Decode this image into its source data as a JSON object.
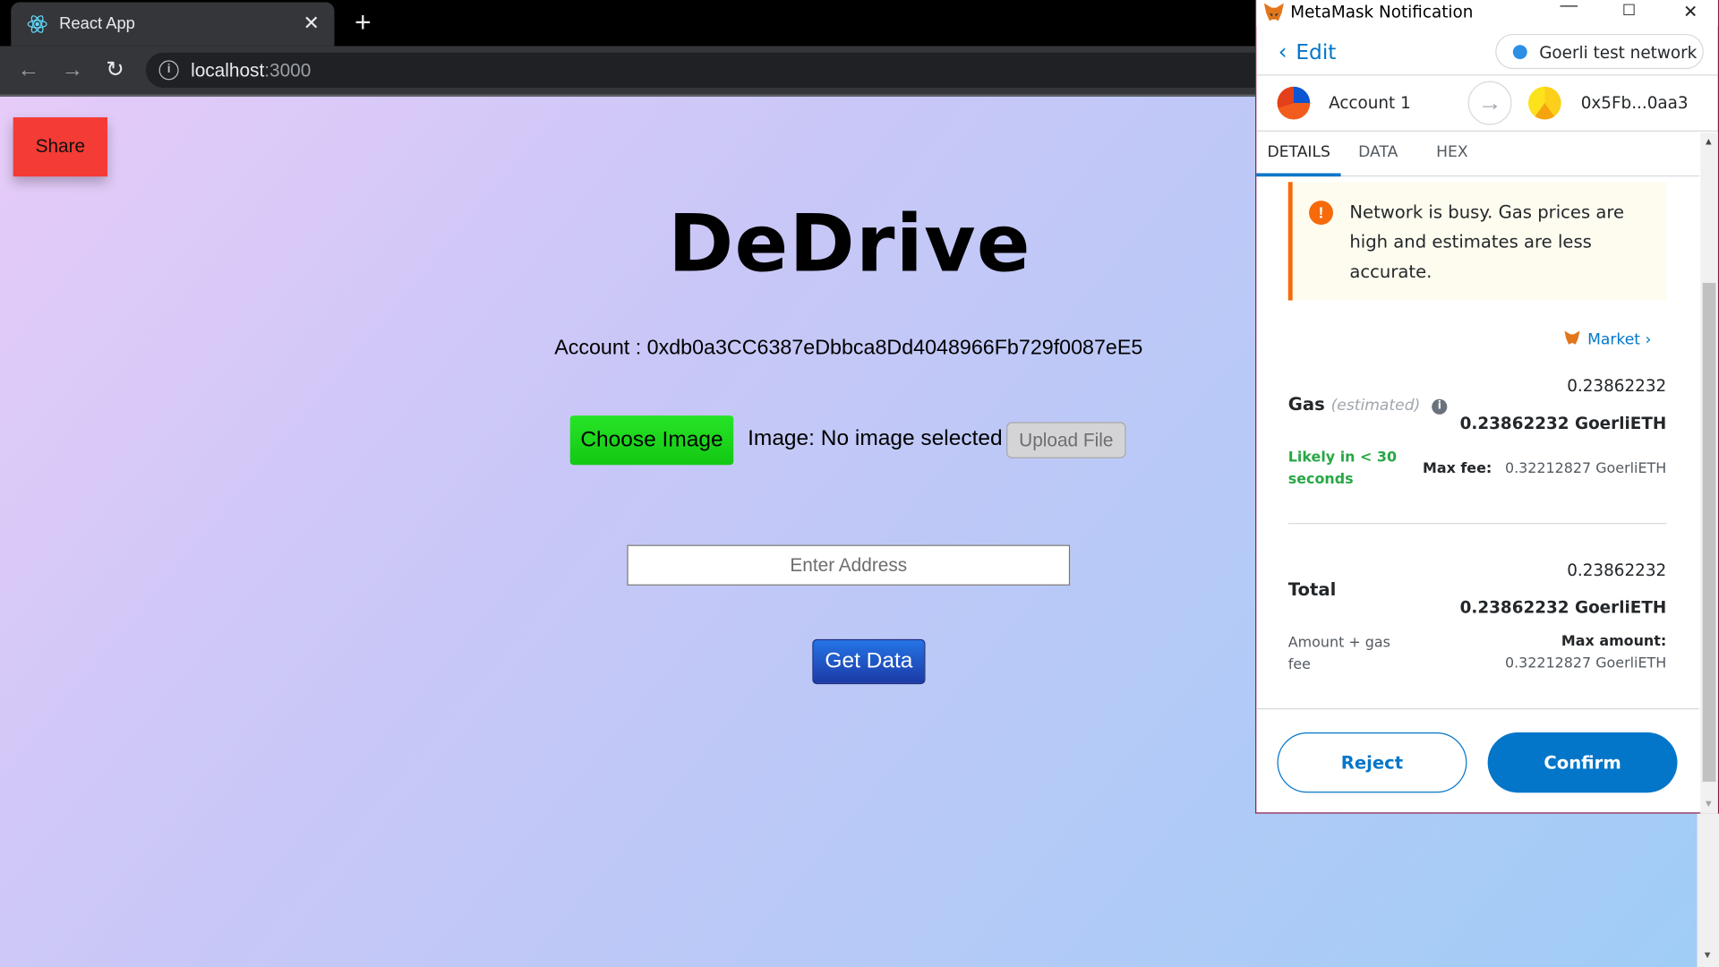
{
  "browser": {
    "tab_title": "React App",
    "tab_close": "✕",
    "new_tab": "+",
    "url_host": "localhost",
    "url_port": ":3000"
  },
  "page": {
    "share_label": "Share",
    "title": "DeDrive",
    "account_line": "Account : 0xdb0a3CC6387eDbbca8Dd4048966Fb729f0087eE5",
    "choose_label": "Choose Image",
    "image_status": "Image: No image selected",
    "upload_label": "Upload File",
    "address_placeholder": "Enter Address",
    "get_data_label": "Get Data"
  },
  "metamask": {
    "window_title": "MetaMask Notification",
    "edit_label": "Edit",
    "network": "Goerli test network",
    "from_account": "Account 1",
    "to_account": "0x5Fb...0aa3",
    "tabs": [
      "DETAILS",
      "DATA",
      "HEX"
    ],
    "warning_text": "Network is busy. Gas prices are high and estimates are less accurate.",
    "market_label": "Market",
    "gas": {
      "label": "Gas",
      "estimated": "(estimated)",
      "value": "0.23862232",
      "value_eth": "0.23862232 GoerliETH",
      "likely": "Likely in < 30 seconds",
      "max_fee_label": "Max fee:",
      "max_fee_value": "0.32212827 GoerliETH"
    },
    "total": {
      "label": "Total",
      "value": "0.23862232",
      "value_eth": "0.23862232 GoerliETH",
      "amount_gas": "Amount + gas fee",
      "max_amount_label": "Max amount:",
      "max_amount_value": "0.32212827 GoerliETH"
    },
    "reject_label": "Reject",
    "confirm_label": "Confirm"
  },
  "colors": {
    "share_red": "#f43b35",
    "choose_green": "#13c813",
    "metamask_blue": "#0376c9",
    "warning_orange": "#f66a0a",
    "likely_green": "#28a745"
  }
}
